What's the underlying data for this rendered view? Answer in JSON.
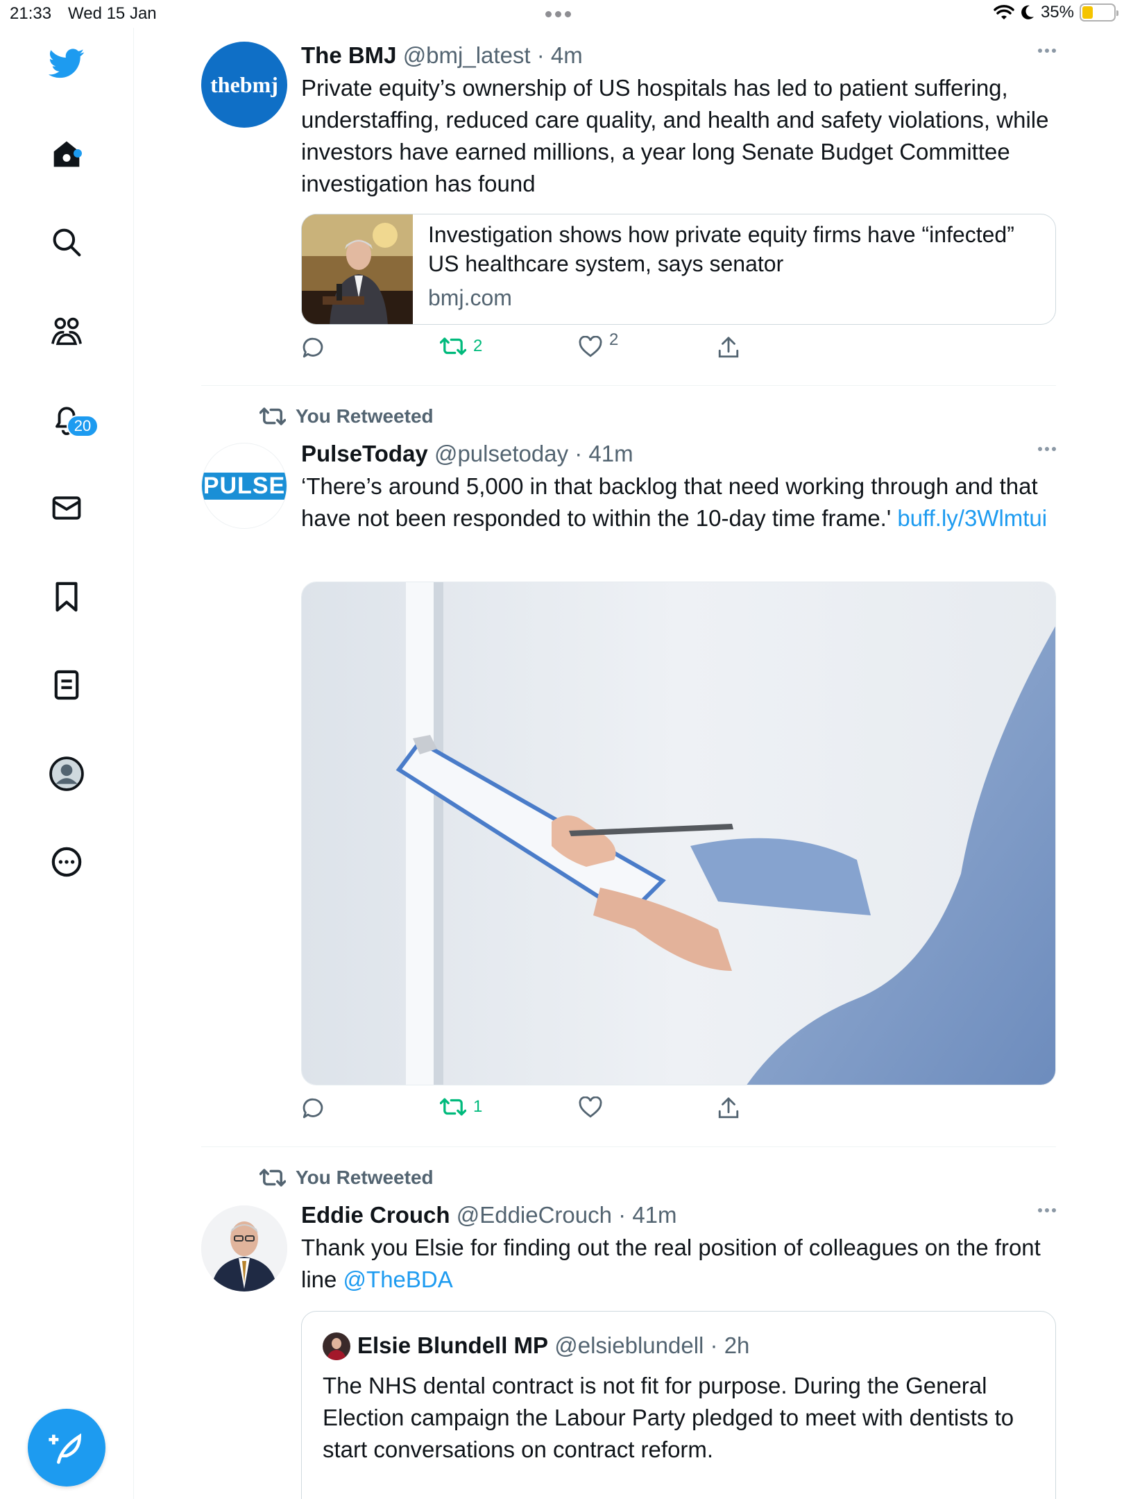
{
  "status_bar": {
    "time": "21:33",
    "date": "Wed 15 Jan",
    "battery": "35%"
  },
  "sidebar": {
    "notifications_badge": "20",
    "items": [
      "home",
      "search",
      "communities",
      "notifications",
      "messages",
      "bookmarks",
      "lists",
      "profile",
      "more"
    ]
  },
  "tweets": [
    {
      "name": "The BMJ",
      "handle": "@bmj_latest",
      "sep": " · ",
      "time": "4m",
      "avatar_text": "thebmj",
      "text": "Private equity’s ownership of US hospitals has led to patient suffering, understaffing, reduced care quality, and health and safety violations, while investors have earned millions, a year long Senate Budget Committee investigation has found",
      "card": {
        "title": "Investigation shows how private equity firms have “infected” US healthcare system, says senator",
        "domain": "bmj.com"
      },
      "retweets": "2",
      "likes": "2"
    },
    {
      "retweet_label": "You Retweeted",
      "name": "PulseToday",
      "handle": "@pulsetoday",
      "sep": " · ",
      "time": "41m",
      "avatar_text": "PULSE",
      "text": "‘There’s around 5,000 in that backlog that need working through and that have not been responded to within the 10-day time frame.' ",
      "link": "buff.ly/3Wlmtui",
      "retweets": "1"
    },
    {
      "retweet_label": "You Retweeted",
      "name": "Eddie Crouch",
      "handle": "@EddieCrouch",
      "sep": " · ",
      "time": "41m",
      "text": "Thank you Elsie for finding out the real position of colleagues on the front line ",
      "mention": "@TheBDA",
      "quote": {
        "name": "Elsie Blundell MP",
        "handle": "@elsieblundell",
        "sep": " · ",
        "time": "2h",
        "text": "The NHS dental contract is not fit for purpose.  During the General Election campaign the Labour Party pledged to meet with dentists to start conversations on contract reform."
      }
    }
  ],
  "colors": {
    "accent": "#1d9bf0",
    "retweet_green": "#00ba7c",
    "secondary_text": "#536471"
  }
}
